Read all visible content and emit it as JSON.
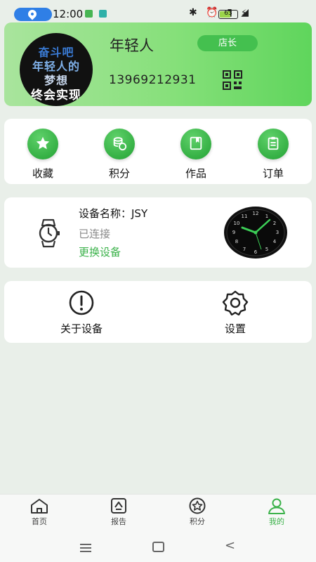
{
  "status_bar": {
    "time": "12:00",
    "battery": "63",
    "right_icons": "✱ ⏰ ▮ ◢"
  },
  "profile": {
    "avatar_lines": [
      "奋斗吧",
      "年轻人的",
      "梦想",
      "终会实现"
    ],
    "username": "年轻人",
    "badge": "店长",
    "phone": "13969212931"
  },
  "quick_actions": [
    {
      "label": "收藏",
      "icon": "star-icon"
    },
    {
      "label": "积分",
      "icon": "coins-icon"
    },
    {
      "label": "作品",
      "icon": "book-icon"
    },
    {
      "label": "订单",
      "icon": "order-icon"
    }
  ],
  "device": {
    "name": "设备名称：JSY",
    "status": "已连接",
    "change_label": "更换设备"
  },
  "settings": [
    {
      "label": "关于设备",
      "icon": "info-icon"
    },
    {
      "label": "设置",
      "icon": "gear-icon"
    }
  ],
  "bottom_nav": [
    {
      "label": "首页",
      "icon": "home-icon"
    },
    {
      "label": "报告",
      "icon": "report-icon"
    },
    {
      "label": "积分",
      "icon": "points-icon"
    },
    {
      "label": "我的",
      "icon": "user-icon",
      "active": true
    }
  ],
  "colors": {
    "accent": "#3bb24a",
    "background": "#e9efe9"
  }
}
